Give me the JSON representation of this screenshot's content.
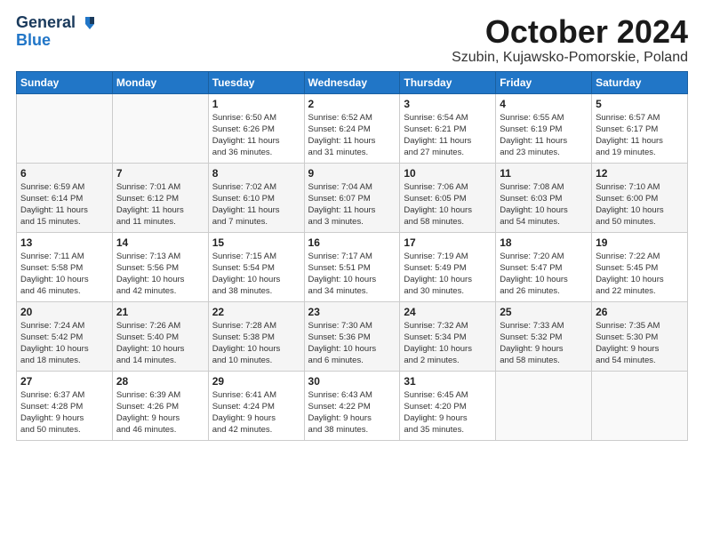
{
  "logo": {
    "line1": "General",
    "line2": "Blue"
  },
  "title": "October 2024",
  "location": "Szubin, Kujawsko-Pomorskie, Poland",
  "days_of_week": [
    "Sunday",
    "Monday",
    "Tuesday",
    "Wednesday",
    "Thursday",
    "Friday",
    "Saturday"
  ],
  "weeks": [
    [
      {
        "num": "",
        "info": ""
      },
      {
        "num": "",
        "info": ""
      },
      {
        "num": "1",
        "info": "Sunrise: 6:50 AM\nSunset: 6:26 PM\nDaylight: 11 hours\nand 36 minutes."
      },
      {
        "num": "2",
        "info": "Sunrise: 6:52 AM\nSunset: 6:24 PM\nDaylight: 11 hours\nand 31 minutes."
      },
      {
        "num": "3",
        "info": "Sunrise: 6:54 AM\nSunset: 6:21 PM\nDaylight: 11 hours\nand 27 minutes."
      },
      {
        "num": "4",
        "info": "Sunrise: 6:55 AM\nSunset: 6:19 PM\nDaylight: 11 hours\nand 23 minutes."
      },
      {
        "num": "5",
        "info": "Sunrise: 6:57 AM\nSunset: 6:17 PM\nDaylight: 11 hours\nand 19 minutes."
      }
    ],
    [
      {
        "num": "6",
        "info": "Sunrise: 6:59 AM\nSunset: 6:14 PM\nDaylight: 11 hours\nand 15 minutes."
      },
      {
        "num": "7",
        "info": "Sunrise: 7:01 AM\nSunset: 6:12 PM\nDaylight: 11 hours\nand 11 minutes."
      },
      {
        "num": "8",
        "info": "Sunrise: 7:02 AM\nSunset: 6:10 PM\nDaylight: 11 hours\nand 7 minutes."
      },
      {
        "num": "9",
        "info": "Sunrise: 7:04 AM\nSunset: 6:07 PM\nDaylight: 11 hours\nand 3 minutes."
      },
      {
        "num": "10",
        "info": "Sunrise: 7:06 AM\nSunset: 6:05 PM\nDaylight: 10 hours\nand 58 minutes."
      },
      {
        "num": "11",
        "info": "Sunrise: 7:08 AM\nSunset: 6:03 PM\nDaylight: 10 hours\nand 54 minutes."
      },
      {
        "num": "12",
        "info": "Sunrise: 7:10 AM\nSunset: 6:00 PM\nDaylight: 10 hours\nand 50 minutes."
      }
    ],
    [
      {
        "num": "13",
        "info": "Sunrise: 7:11 AM\nSunset: 5:58 PM\nDaylight: 10 hours\nand 46 minutes."
      },
      {
        "num": "14",
        "info": "Sunrise: 7:13 AM\nSunset: 5:56 PM\nDaylight: 10 hours\nand 42 minutes."
      },
      {
        "num": "15",
        "info": "Sunrise: 7:15 AM\nSunset: 5:54 PM\nDaylight: 10 hours\nand 38 minutes."
      },
      {
        "num": "16",
        "info": "Sunrise: 7:17 AM\nSunset: 5:51 PM\nDaylight: 10 hours\nand 34 minutes."
      },
      {
        "num": "17",
        "info": "Sunrise: 7:19 AM\nSunset: 5:49 PM\nDaylight: 10 hours\nand 30 minutes."
      },
      {
        "num": "18",
        "info": "Sunrise: 7:20 AM\nSunset: 5:47 PM\nDaylight: 10 hours\nand 26 minutes."
      },
      {
        "num": "19",
        "info": "Sunrise: 7:22 AM\nSunset: 5:45 PM\nDaylight: 10 hours\nand 22 minutes."
      }
    ],
    [
      {
        "num": "20",
        "info": "Sunrise: 7:24 AM\nSunset: 5:42 PM\nDaylight: 10 hours\nand 18 minutes."
      },
      {
        "num": "21",
        "info": "Sunrise: 7:26 AM\nSunset: 5:40 PM\nDaylight: 10 hours\nand 14 minutes."
      },
      {
        "num": "22",
        "info": "Sunrise: 7:28 AM\nSunset: 5:38 PM\nDaylight: 10 hours\nand 10 minutes."
      },
      {
        "num": "23",
        "info": "Sunrise: 7:30 AM\nSunset: 5:36 PM\nDaylight: 10 hours\nand 6 minutes."
      },
      {
        "num": "24",
        "info": "Sunrise: 7:32 AM\nSunset: 5:34 PM\nDaylight: 10 hours\nand 2 minutes."
      },
      {
        "num": "25",
        "info": "Sunrise: 7:33 AM\nSunset: 5:32 PM\nDaylight: 9 hours\nand 58 minutes."
      },
      {
        "num": "26",
        "info": "Sunrise: 7:35 AM\nSunset: 5:30 PM\nDaylight: 9 hours\nand 54 minutes."
      }
    ],
    [
      {
        "num": "27",
        "info": "Sunrise: 6:37 AM\nSunset: 4:28 PM\nDaylight: 9 hours\nand 50 minutes."
      },
      {
        "num": "28",
        "info": "Sunrise: 6:39 AM\nSunset: 4:26 PM\nDaylight: 9 hours\nand 46 minutes."
      },
      {
        "num": "29",
        "info": "Sunrise: 6:41 AM\nSunset: 4:24 PM\nDaylight: 9 hours\nand 42 minutes."
      },
      {
        "num": "30",
        "info": "Sunrise: 6:43 AM\nSunset: 4:22 PM\nDaylight: 9 hours\nand 38 minutes."
      },
      {
        "num": "31",
        "info": "Sunrise: 6:45 AM\nSunset: 4:20 PM\nDaylight: 9 hours\nand 35 minutes."
      },
      {
        "num": "",
        "info": ""
      },
      {
        "num": "",
        "info": ""
      }
    ]
  ]
}
